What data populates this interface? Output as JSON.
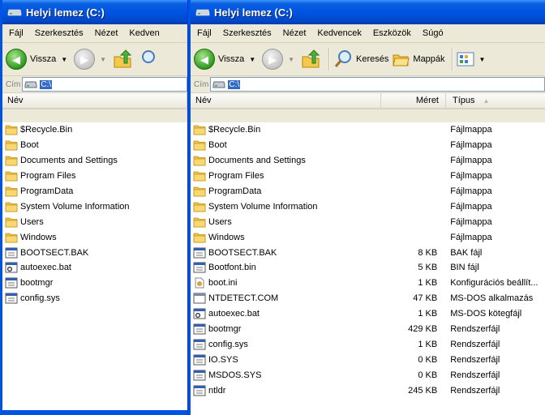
{
  "left_window": {
    "title": "Helyi lemez (C:)",
    "menu": [
      "Fájl",
      "Szerkesztés",
      "Nézet",
      "Kedven"
    ],
    "toolbar": {
      "back": "Vissza"
    },
    "address": {
      "label": "Cím",
      "value": "C:\\"
    },
    "columns": {
      "name": "Név"
    },
    "items": [
      {
        "name": "$Recycle.Bin",
        "icon": "folder-icon"
      },
      {
        "name": "Boot",
        "icon": "folder-icon"
      },
      {
        "name": "Documents and Settings",
        "icon": "folder-icon"
      },
      {
        "name": "Program Files",
        "icon": "folder-icon"
      },
      {
        "name": "ProgramData",
        "icon": "folder-icon"
      },
      {
        "name": "System Volume Information",
        "icon": "folder-icon"
      },
      {
        "name": "Users",
        "icon": "folder-icon"
      },
      {
        "name": "Windows",
        "icon": "folder-icon"
      },
      {
        "name": "BOOTSECT.BAK",
        "icon": "system-file-icon"
      },
      {
        "name": "autoexec.bat",
        "icon": "batch-file-icon"
      },
      {
        "name": "bootmgr",
        "icon": "system-file-icon"
      },
      {
        "name": "config.sys",
        "icon": "system-file-icon"
      }
    ]
  },
  "right_window": {
    "title": "Helyi lemez (C:)",
    "menu": [
      "Fájl",
      "Szerkesztés",
      "Nézet",
      "Kedvencek",
      "Eszközök",
      "Súgó"
    ],
    "toolbar": {
      "back": "Vissza",
      "search": "Keresés",
      "folders": "Mappák"
    },
    "address": {
      "label": "Cím",
      "value": "C:\\"
    },
    "columns": {
      "name": "Név",
      "size": "Méret",
      "type": "Típus"
    },
    "items": [
      {
        "name": "$Recycle.Bin",
        "size": "",
        "type": "Fájlmappa",
        "icon": "folder-icon"
      },
      {
        "name": "Boot",
        "size": "",
        "type": "Fájlmappa",
        "icon": "folder-icon"
      },
      {
        "name": "Documents and Settings",
        "size": "",
        "type": "Fájlmappa",
        "icon": "folder-icon"
      },
      {
        "name": "Program Files",
        "size": "",
        "type": "Fájlmappa",
        "icon": "folder-icon"
      },
      {
        "name": "ProgramData",
        "size": "",
        "type": "Fájlmappa",
        "icon": "folder-icon"
      },
      {
        "name": "System Volume Information",
        "size": "",
        "type": "Fájlmappa",
        "icon": "folder-icon"
      },
      {
        "name": "Users",
        "size": "",
        "type": "Fájlmappa",
        "icon": "folder-icon"
      },
      {
        "name": "Windows",
        "size": "",
        "type": "Fájlmappa",
        "icon": "folder-icon"
      },
      {
        "name": "BOOTSECT.BAK",
        "size": "8 KB",
        "type": "BAK fájl",
        "icon": "system-file-icon"
      },
      {
        "name": "Bootfont.bin",
        "size": "5 KB",
        "type": "BIN fájl",
        "icon": "system-file-icon"
      },
      {
        "name": "boot.ini",
        "size": "1 KB",
        "type": "Konfigurációs beállít...",
        "icon": "config-file-icon"
      },
      {
        "name": "NTDETECT.COM",
        "size": "47 KB",
        "type": "MS-DOS alkalmazás",
        "icon": "dos-app-icon"
      },
      {
        "name": "autoexec.bat",
        "size": "1 KB",
        "type": "MS-DOS kötegfájl",
        "icon": "batch-file-icon"
      },
      {
        "name": "bootmgr",
        "size": "429 KB",
        "type": "Rendszerfájl",
        "icon": "system-file-icon"
      },
      {
        "name": "config.sys",
        "size": "1 KB",
        "type": "Rendszerfájl",
        "icon": "system-file-icon"
      },
      {
        "name": "IO.SYS",
        "size": "0 KB",
        "type": "Rendszerfájl",
        "icon": "system-file-icon"
      },
      {
        "name": "MSDOS.SYS",
        "size": "0 KB",
        "type": "Rendszerfájl",
        "icon": "system-file-icon"
      },
      {
        "name": "ntldr",
        "size": "245 KB",
        "type": "Rendszerfájl",
        "icon": "system-file-icon"
      }
    ]
  }
}
